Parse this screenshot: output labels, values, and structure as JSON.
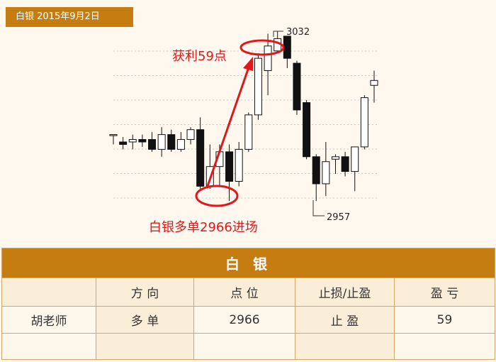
{
  "header": {
    "title": "白银 2015年9月2日"
  },
  "chart_data": {
    "type": "candlestick",
    "title": "白银 2015年9月2日",
    "ylim": [
      2945,
      3040
    ],
    "candles": [
      {
        "o": 2990,
        "h": 2990,
        "l": 2986,
        "c": 2990
      },
      {
        "o": 2987,
        "h": 2989,
        "l": 2984,
        "c": 2986
      },
      {
        "o": 2987,
        "h": 2990,
        "l": 2984,
        "c": 2988
      },
      {
        "o": 2988,
        "h": 2990,
        "l": 2985,
        "c": 2987
      },
      {
        "o": 2988,
        "h": 2991,
        "l": 2983,
        "c": 2984
      },
      {
        "o": 2984,
        "h": 2993,
        "l": 2981,
        "c": 2990
      },
      {
        "o": 2990,
        "h": 2992,
        "l": 2983,
        "c": 2984
      },
      {
        "o": 2984,
        "h": 2991,
        "l": 2983,
        "c": 2988
      },
      {
        "o": 2988,
        "h": 2993,
        "l": 2986,
        "c": 2992
      },
      {
        "o": 2992,
        "h": 2997,
        "l": 2968,
        "c": 2969
      },
      {
        "o": 2969,
        "h": 2986,
        "l": 2968,
        "c": 2977
      },
      {
        "o": 2977,
        "h": 2986,
        "l": 2969,
        "c": 2983
      },
      {
        "o": 2983,
        "h": 2986,
        "l": 2963,
        "c": 2971
      },
      {
        "o": 2971,
        "h": 2987,
        "l": 2969,
        "c": 2984
      },
      {
        "o": 2984,
        "h": 2999,
        "l": 2983,
        "c": 2998
      },
      {
        "o": 2998,
        "h": 3023,
        "l": 2996,
        "c": 3021
      },
      {
        "o": 3016,
        "h": 3031,
        "l": 3006,
        "c": 3026
      },
      {
        "o": 3024,
        "h": 3032,
        "l": 3023,
        "c": 3029
      },
      {
        "o": 3030,
        "h": 3030,
        "l": 3017,
        "c": 3021
      },
      {
        "o": 3019,
        "h": 3020,
        "l": 2998,
        "c": 3000
      },
      {
        "o": 3003,
        "h": 3004,
        "l": 2980,
        "c": 2981
      },
      {
        "o": 2981,
        "h": 2982,
        "l": 2963,
        "c": 2970
      },
      {
        "o": 2970,
        "h": 2987,
        "l": 2965,
        "c": 2979
      },
      {
        "o": 2980,
        "h": 2982,
        "l": 2974,
        "c": 2981
      },
      {
        "o": 2981,
        "h": 2983,
        "l": 2973,
        "c": 2975
      },
      {
        "o": 2975,
        "h": 2985,
        "l": 2967,
        "c": 2985
      },
      {
        "o": 2985,
        "h": 3006,
        "l": 2984,
        "c": 3005
      },
      {
        "o": 3010,
        "h": 3016,
        "l": 3003,
        "c": 3012
      }
    ],
    "annotations": {
      "high_label": "3032",
      "low_label": "2957",
      "profit_label": "获利59点",
      "entry_label": "白银多单2966进场"
    }
  },
  "table": {
    "title": "白  银",
    "headers": [
      "",
      "方 向",
      "点 位",
      "止损/止盈",
      "盈 亏"
    ],
    "rows": [
      [
        "胡老师",
        "多 单",
        "2966",
        "止 盈",
        "59"
      ],
      [
        "",
        "",
        "",
        "",
        ""
      ]
    ]
  }
}
